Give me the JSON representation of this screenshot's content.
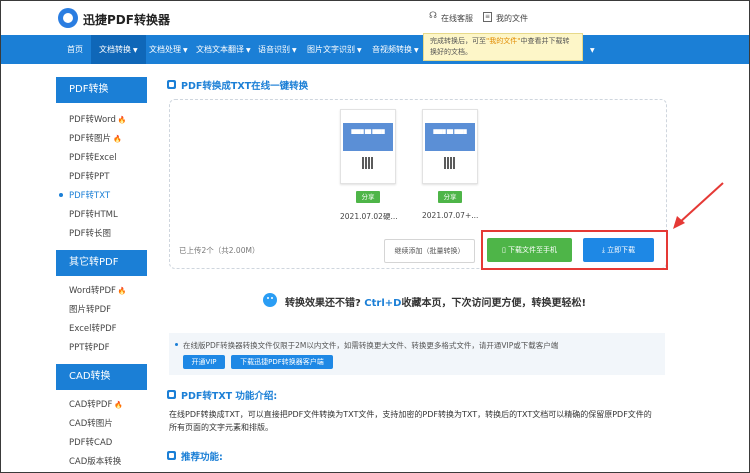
{
  "header": {
    "brand": "迅捷PDF转换器",
    "service_label": "在线客服",
    "files_label": "我的文件"
  },
  "nav": {
    "items": [
      "首页",
      "文档转换",
      "文档处理",
      "文档文本翻译",
      "语音识别",
      "图片文字识别",
      "音视频转换"
    ],
    "active_index": 1
  },
  "tooltip": {
    "part1": "完成转换后，可至",
    "highlight": "\"我的文件\"",
    "part2": "中查看并下载转换好的文档。"
  },
  "sidebar": {
    "groups": [
      {
        "title": "PDF转换",
        "items": [
          {
            "label": "PDF转Word",
            "hot": true
          },
          {
            "label": "PDF转图片",
            "hot": true
          },
          {
            "label": "PDF转Excel",
            "hot": false
          },
          {
            "label": "PDF转PPT",
            "hot": false
          },
          {
            "label": "PDF转TXT",
            "hot": false,
            "current": true
          },
          {
            "label": "PDF转HTML",
            "hot": false
          },
          {
            "label": "PDF转长图",
            "hot": false
          }
        ]
      },
      {
        "title": "其它转PDF",
        "items": [
          {
            "label": "Word转PDF",
            "hot": true
          },
          {
            "label": "图片转PDF",
            "hot": false
          },
          {
            "label": "Excel转PDF",
            "hot": false
          },
          {
            "label": "PPT转PDF",
            "hot": false
          }
        ]
      },
      {
        "title": "CAD转换",
        "items": [
          {
            "label": "CAD转PDF",
            "hot": true
          },
          {
            "label": "CAD转图片",
            "hot": false
          },
          {
            "label": "PDF转CAD",
            "hot": false
          },
          {
            "label": "CAD版本转换",
            "hot": false
          }
        ]
      }
    ]
  },
  "main": {
    "title": "PDF转换成TXT在线一键转换",
    "files": [
      {
        "name": "2021.07.02硬...",
        "share": "分享"
      },
      {
        "name": "2021.07.07+...",
        "share": "分享"
      }
    ],
    "upload_count": "已上传2个（共2.00M）",
    "continue_button": "继续添加（批量转换）",
    "phone_button": "下载文件至手机",
    "download_button": "立即下载",
    "promo_prefix": "转换效果还不错?",
    "promo_key": "Ctrl+D",
    "promo_suffix": "收藏本页，下次访问更方便，转换更轻松!",
    "notice": "在线版PDF转换器转换文件仅限于2M以内文件，如需转换更大文件、转换更多格式文件，请开通VIP或下载客户端",
    "vip_button": "开通VIP",
    "client_button": "下载迅捷PDF转换器客户端",
    "intro_title": "PDF转TXT 功能介绍:",
    "intro_line1": "在线PDF转换成TXT，可以直接把PDF文件转换为TXT文件，支持加密的PDF转换为TXT，转换后的TXT文档可以精确的保留原PDF文件的",
    "intro_line2": "所有页面的文字元素和排版。",
    "recommend_title": "推荐功能:"
  },
  "colors": {
    "brand_blue": "#1b7fd6",
    "green": "#4eb548",
    "highlight_red": "#e53935"
  }
}
